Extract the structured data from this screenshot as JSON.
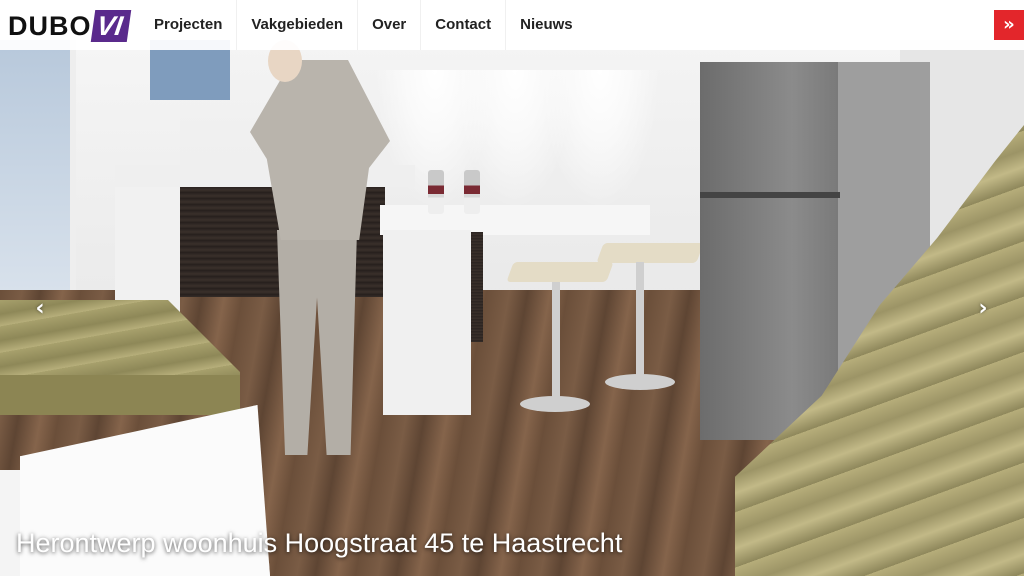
{
  "brand": {
    "logo_part1": "DUBO",
    "logo_part2": "VI",
    "accent_color": "#5a2a8c"
  },
  "nav": {
    "items": [
      {
        "label": "Projecten"
      },
      {
        "label": "Vakgebieden"
      },
      {
        "label": "Over"
      },
      {
        "label": "Contact"
      },
      {
        "label": "Nieuws"
      }
    ]
  },
  "menu_button": {
    "icon": "double-chevron-right-icon",
    "glyph": "»",
    "color": "#e3262b"
  },
  "slider": {
    "prev_glyph": "‹",
    "next_glyph": "›",
    "caption": "Herontwerp woonhuis Hoogstraat 45 te Haastrecht"
  }
}
